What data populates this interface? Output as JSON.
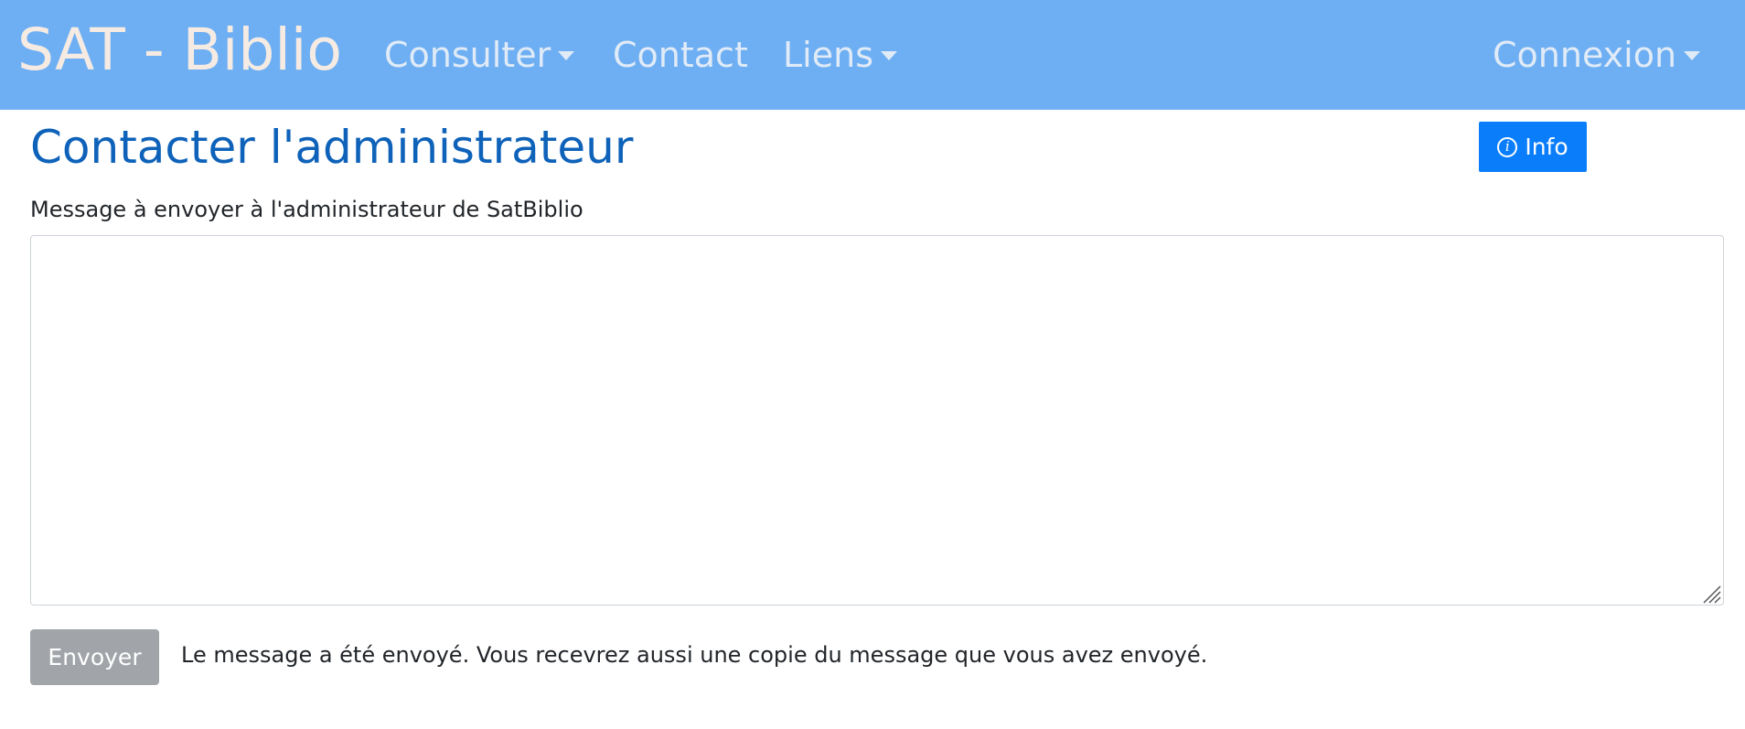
{
  "navbar": {
    "brand": "SAT - Biblio",
    "items": [
      {
        "label": "Consulter",
        "dropdown": true
      },
      {
        "label": "Contact",
        "dropdown": false
      },
      {
        "label": "Liens",
        "dropdown": true
      }
    ],
    "connexion": {
      "label": "Connexion",
      "dropdown": true
    },
    "background_color": "#6eaff3"
  },
  "main": {
    "title": "Contacter l'administrateur",
    "info_button": {
      "label": "Info",
      "icon": "info-circle-icon",
      "color": "#0a7dfb"
    },
    "message_label": "Message à envoyer à l'administrateur de SatBiblio",
    "message_value": "",
    "send_button": {
      "label": "Envoyer",
      "disabled": true
    },
    "status_message": "Le message a été envoyé. Vous recevrez aussi une copie du message que vous avez envoyé."
  }
}
